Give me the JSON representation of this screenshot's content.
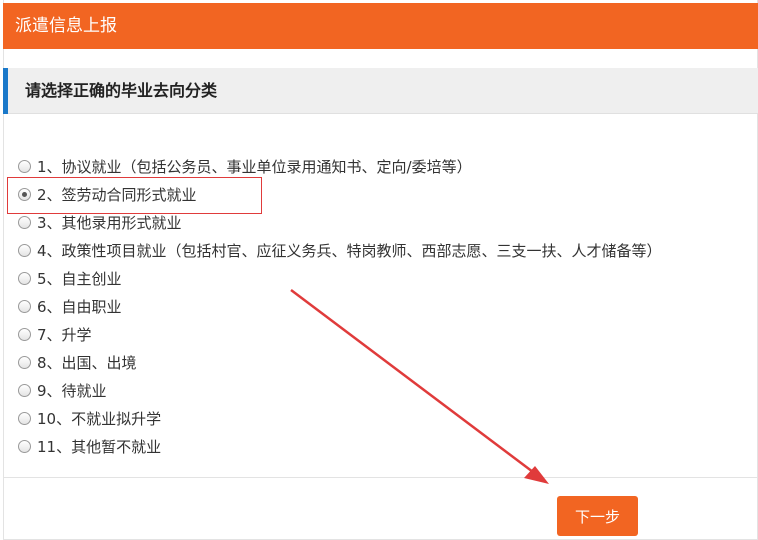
{
  "header": {
    "title": "派遣信息上报"
  },
  "section": {
    "title": "请选择正确的毕业去向分类"
  },
  "options": [
    {
      "label": "1、协议就业（包括公务员、事业单位录用通知书、定向/委培等）",
      "checked": false
    },
    {
      "label": "2、签劳动合同形式就业",
      "checked": true
    },
    {
      "label": "3、其他录用形式就业",
      "checked": false
    },
    {
      "label": "4、政策性项目就业（包括村官、应征义务兵、特岗教师、西部志愿、三支一扶、人才储备等）",
      "checked": false
    },
    {
      "label": "5、自主创业",
      "checked": false
    },
    {
      "label": "6、自由职业",
      "checked": false
    },
    {
      "label": "7、升学",
      "checked": false
    },
    {
      "label": "8、出国、出境",
      "checked": false
    },
    {
      "label": "9、待就业",
      "checked": false
    },
    {
      "label": "10、不就业拟升学",
      "checked": false
    },
    {
      "label": "11、其他暂不就业",
      "checked": false
    }
  ],
  "buttons": {
    "next": "下一步"
  },
  "colors": {
    "accent": "#f26522",
    "section_accent": "#1a78c9",
    "annotation": "#e03b3b"
  }
}
